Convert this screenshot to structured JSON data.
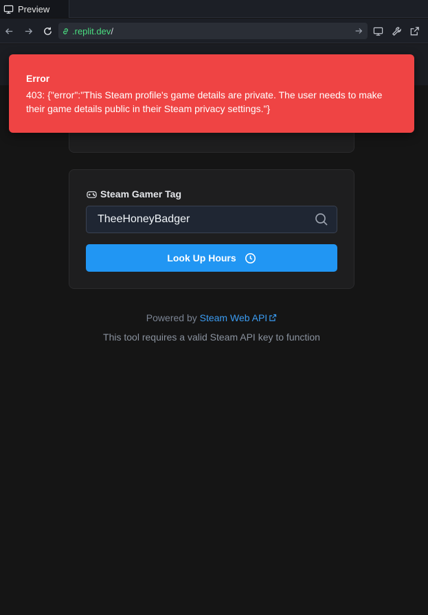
{
  "tab": {
    "label": "Preview",
    "icon": "monitor-icon"
  },
  "urlbar": {
    "host": ".replit.dev",
    "path": "/"
  },
  "toast": {
    "title": "Error",
    "message": "403: {\"error\":\"This Steam profile's game details are private. The user needs to make their game details public in their Steam privacy settings.\"}",
    "color": "#ef4444"
  },
  "form": {
    "label": "Steam Gamer Tag",
    "input_value": "TheeHoneyBadger",
    "button_label": "Look Up Hours",
    "button_color": "#2196f3"
  },
  "footer": {
    "powered_prefix": "Powered by",
    "powered_link": "Steam Web API",
    "note": "This tool requires a valid Steam API key to function"
  }
}
